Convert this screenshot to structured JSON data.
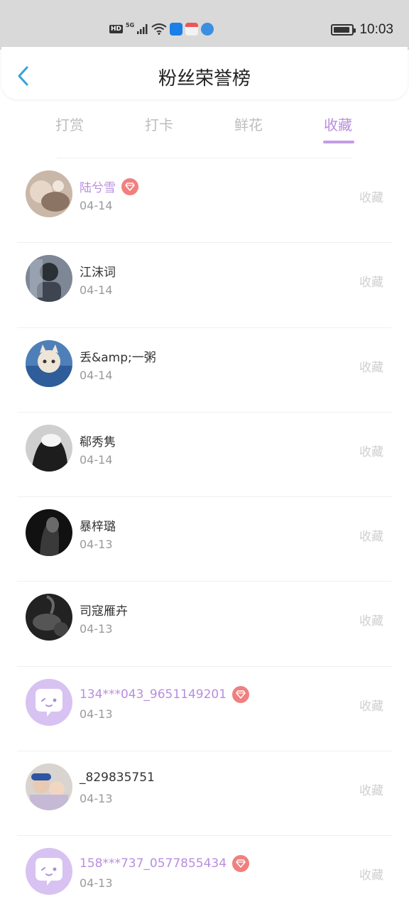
{
  "status_bar": {
    "network_badge": "HD",
    "network_type": "5G",
    "time": "10:03",
    "battery_level": 0.9
  },
  "header": {
    "title": "粉丝荣誉榜"
  },
  "tabs": [
    {
      "label": "打赏",
      "active": false
    },
    {
      "label": "打卡",
      "active": false
    },
    {
      "label": "鲜花",
      "active": false
    },
    {
      "label": "收藏",
      "active": true
    }
  ],
  "colors": {
    "accent": "#b98ddf",
    "badge": "#f08080",
    "muted_text": "#9a9a9a",
    "action_text": "#cfcfcf"
  },
  "fans": [
    {
      "name": "陆兮雪",
      "date": "04-14",
      "action": "收藏",
      "vip": true,
      "avatar": "photo-cat-paw"
    },
    {
      "name": "江沫词",
      "date": "04-14",
      "action": "收藏",
      "vip": false,
      "avatar": "photo-person"
    },
    {
      "name": "丢&amp;一粥",
      "date": "04-14",
      "action": "收藏",
      "vip": false,
      "avatar": "photo-cat"
    },
    {
      "name": "郗秀隽",
      "date": "04-14",
      "action": "收藏",
      "vip": false,
      "avatar": "photo-hood"
    },
    {
      "name": "暴梓璐",
      "date": "04-13",
      "action": "收藏",
      "vip": false,
      "avatar": "photo-dark"
    },
    {
      "name": "司寇雁卉",
      "date": "04-13",
      "action": "收藏",
      "vip": false,
      "avatar": "photo-smoke"
    },
    {
      "name": "134***043_9651149201",
      "date": "04-13",
      "action": "收藏",
      "vip": true,
      "avatar": "default-chat-icon"
    },
    {
      "name": "_829835751",
      "date": "04-13",
      "action": "收藏",
      "vip": false,
      "avatar": "photo-kids"
    },
    {
      "name": "158***737_0577855434",
      "date": "04-13",
      "action": "收藏",
      "vip": true,
      "avatar": "default-chat-icon"
    }
  ]
}
